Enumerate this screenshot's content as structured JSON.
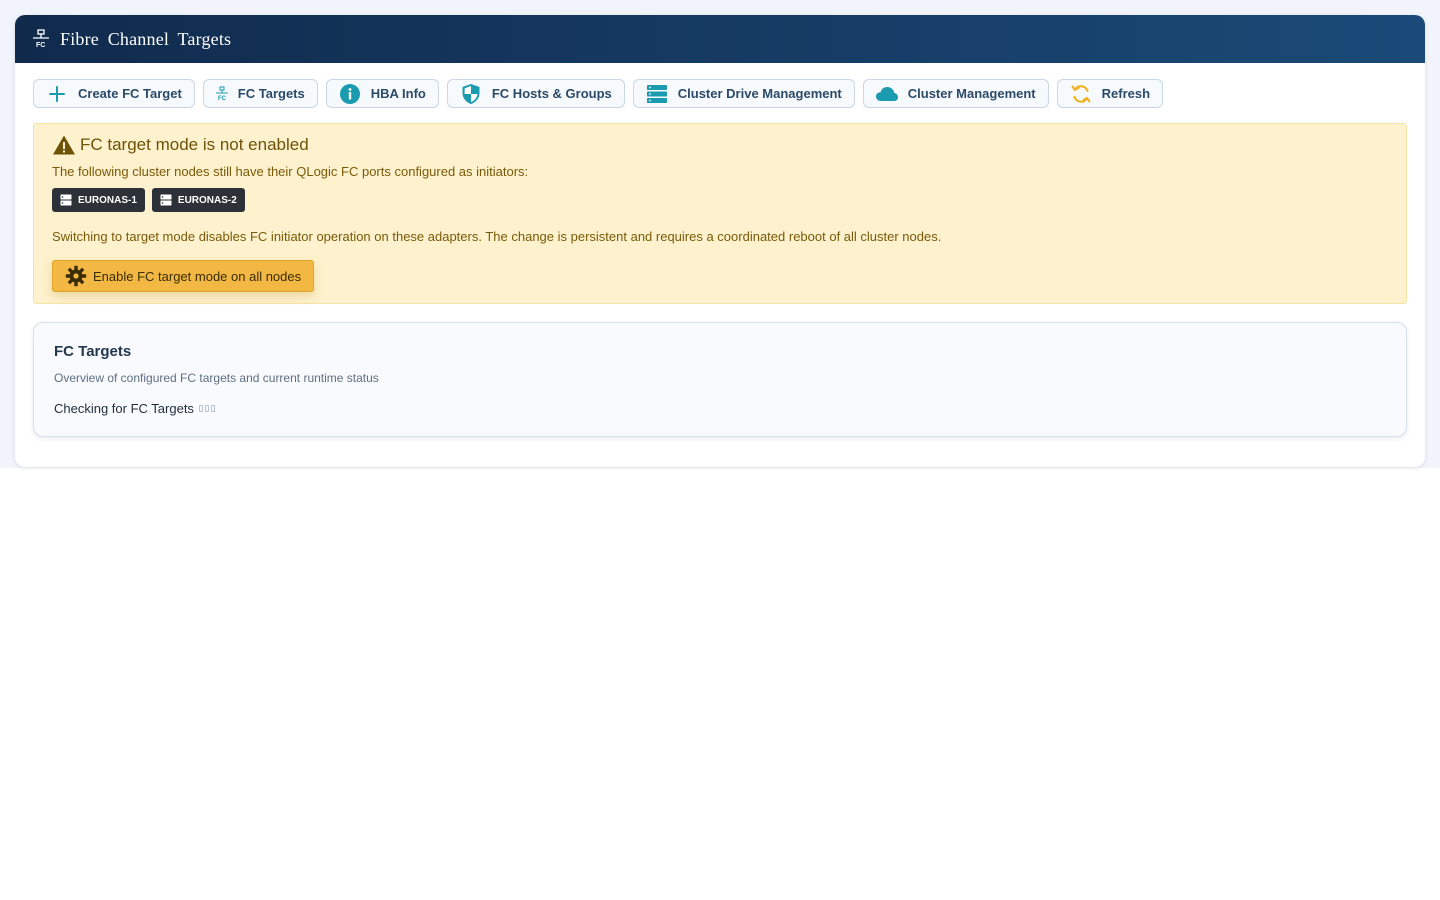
{
  "window": {
    "title": "Fibre Channel Targets",
    "title_icon": "fc-network-icon"
  },
  "toolbar": [
    {
      "label": "Create FC Target",
      "icon": "plus-icon"
    },
    {
      "label": "FC Targets",
      "icon": "fc-network-icon"
    },
    {
      "label": "HBA Info",
      "icon": "info-circle-icon"
    },
    {
      "label": "FC Hosts & Groups",
      "icon": "shield-icon"
    },
    {
      "label": "Cluster Drive Management",
      "icon": "server-stack-icon"
    },
    {
      "label": "Cluster Management",
      "icon": "cloud-icon"
    },
    {
      "label": "Refresh",
      "icon": "refresh-icon"
    }
  ],
  "alert": {
    "title": "FC target mode is not enabled",
    "line1": "The following cluster nodes still have their QLogic FC ports configured as initiators:",
    "nodes": [
      "EURONAS-1",
      "EURONAS-2"
    ],
    "line2": "Switching to target mode disables FC initiator operation on these adapters. The change is persistent and requires a coordinated reboot of all cluster nodes.",
    "action_label": "Enable FC target mode on all nodes"
  },
  "card": {
    "title": "FC Targets",
    "subtitle": "Overview of configured FC targets and current runtime status",
    "status": "Checking for FC Targets"
  },
  "colors": {
    "accent": "#1a9bb0",
    "header_start": "#102a4c",
    "header_end": "#1b4a78",
    "warning_bg": "#fdf2cd",
    "warning_button": "#f2b843",
    "refresh_icon": "#f0b020"
  }
}
